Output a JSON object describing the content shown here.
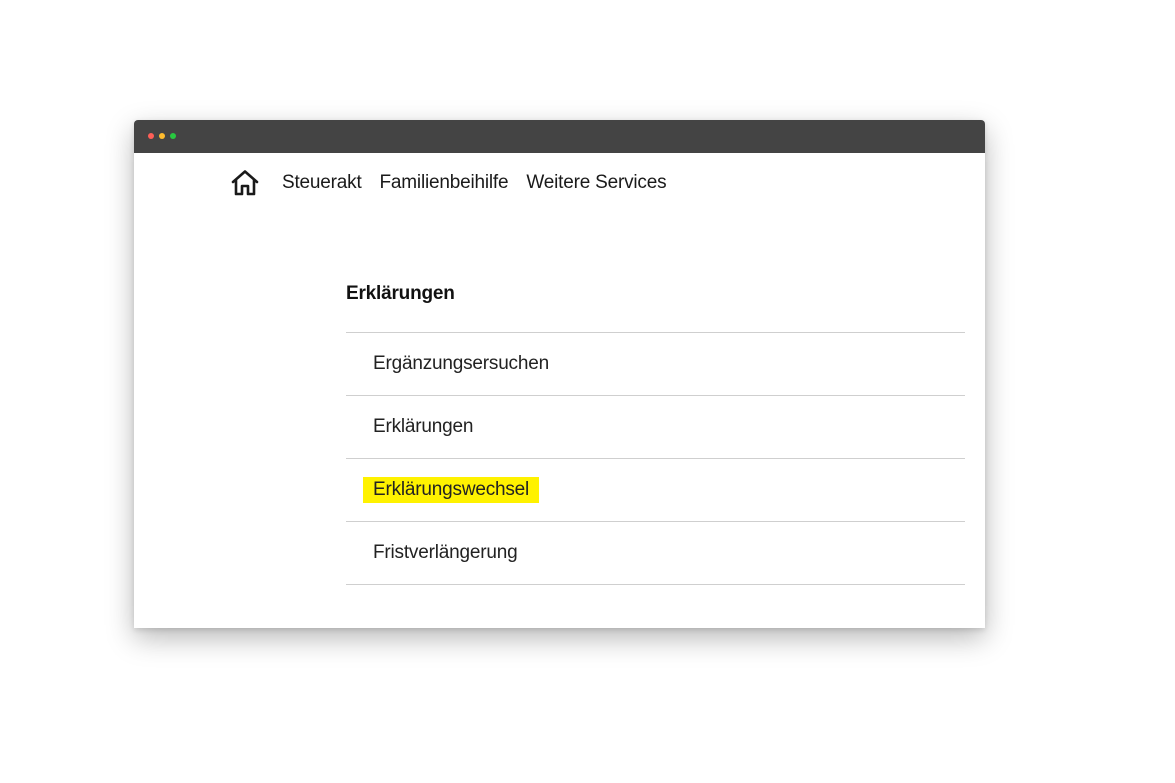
{
  "colors": {
    "titlebar": "#444444",
    "dot_red": "#ff5f57",
    "dot_yellow": "#febc2e",
    "dot_green": "#28c840",
    "highlight": "#fff200",
    "divider": "#cfcfcf"
  },
  "nav": {
    "home_icon": "home-icon",
    "links": [
      "Steuerakt",
      "Familienbeihilfe",
      "Weitere Services"
    ]
  },
  "section": {
    "heading": "Erklärungen",
    "items": [
      {
        "label": "Ergänzungsersuchen",
        "highlighted": false
      },
      {
        "label": "Erklärungen",
        "highlighted": false
      },
      {
        "label": "Erklärungswechsel",
        "highlighted": true
      },
      {
        "label": "Fristverlängerung",
        "highlighted": false
      }
    ]
  }
}
